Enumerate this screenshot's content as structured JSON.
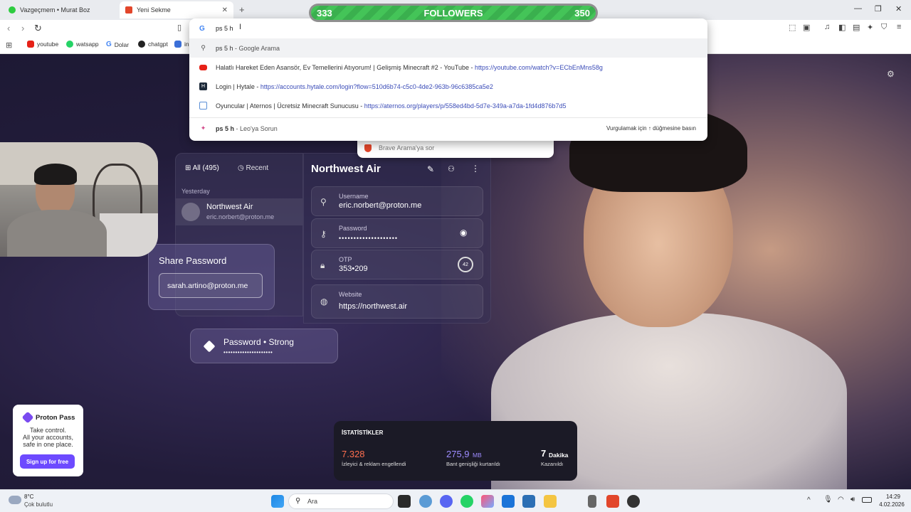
{
  "browser": {
    "tabs": [
      {
        "title": "Vazgeçmem • Murat Boz"
      },
      {
        "title": "Yeni Sekme"
      }
    ],
    "new_tab": "+",
    "address_value": "ps 5 h",
    "bookmarks": [
      "youtube",
      "watsapp",
      "Dolar",
      "chatgpt",
      "in"
    ]
  },
  "followers": {
    "current": "333",
    "label": "FOLLOWERS",
    "goal": "350",
    "progress": 0.95
  },
  "omnibox": {
    "suggestions": [
      {
        "type": "search",
        "bold": "ps 5 h",
        "text": " - Google Arama",
        "url": ""
      },
      {
        "type": "youtube",
        "bold": "",
        "text": "Halatlı Hareket Eden Asansör, Ev Temellerini Atıyorum! | Gelişmiş Minecraft #2 - YouTube - ",
        "url": "https://youtube.com/watch?v=ECbEnMns58g"
      },
      {
        "type": "hytale",
        "bold": "",
        "text": "Login | Hytale - ",
        "url": "https://accounts.hytale.com/login?flow=510d6b74-c5c0-4de2-963b-96c6385ca5e2"
      },
      {
        "type": "aternos",
        "bold": "",
        "text": "Oyuncular | Aternos | Ücretsiz Minecraft Sunucusu - ",
        "url": "https://aternos.org/players/p/558ed4bd-5d7e-349a-a7da-1fd4d876b7d5"
      }
    ],
    "leo": {
      "bold": "ps 5 h",
      "text": " - Leo'ya Sorun",
      "hint": "Vurgulamak için ↑ düğmesine basın"
    },
    "brave_ask": "Brave Arama'ya sor"
  },
  "proton": {
    "filter_all": "All (495)",
    "filter_recent": "Recent",
    "group": "Yesterday",
    "item_title": "Northwest Air",
    "item_sub": "eric.norbert@proton.me",
    "detail_title": "Northwest Air",
    "username_label": "Username",
    "username_value": "eric.norbert@proton.me",
    "password_label": "Password",
    "password_value": "••••••••••••••••••••",
    "otp_label": "OTP",
    "otp_value": "353•209",
    "otp_timer": "42",
    "website_label": "Website",
    "website_value": "https://northwest.air",
    "share_title": "Share Password",
    "share_email": "sarah.artino@proton.me",
    "strong_title": "Password • Strong",
    "strong_dots": "•••••••••••••••••••••"
  },
  "ad": {
    "brand": "Proton Pass",
    "line1": "Take control.",
    "line2": "All your accounts,",
    "line3": "safe in one place.",
    "cta": "Sign up for free"
  },
  "stats": {
    "title": "İSTATİSTİKLER",
    "blocked_value": "7.328",
    "blocked_label": "İzleyici & reklam engellendi",
    "bandwidth_value": "275,9",
    "bandwidth_unit": "MB",
    "bandwidth_label": "Bant genişliği kurtarıldı",
    "time_value": "7",
    "time_unit": "Dakika",
    "time_label": "Kazanıldı"
  },
  "taskbar": {
    "weather_temp": "8°C",
    "weather_desc": "Çok bulutlu",
    "search": "Ara",
    "time": "14:29",
    "date": "4.02.2026"
  }
}
